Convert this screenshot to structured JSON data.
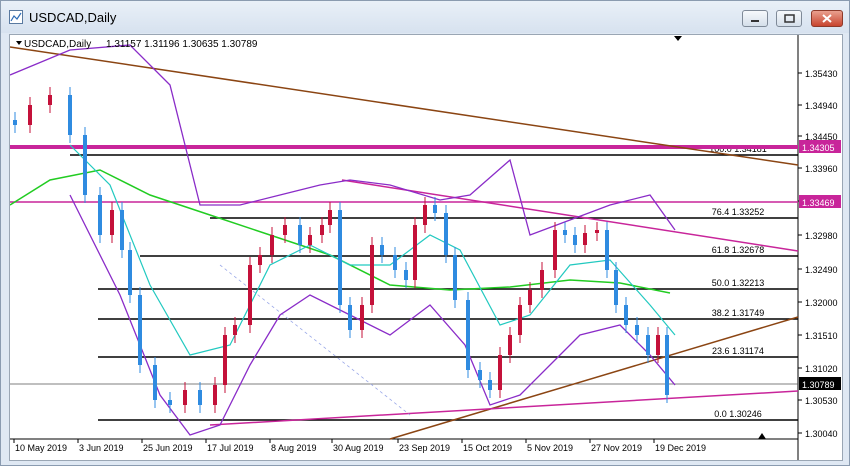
{
  "window": {
    "title": "USDCAD,Daily"
  },
  "chart_data": {
    "type": "candlestick",
    "symbol_label": "USDCAD,Daily",
    "ohlc_label": "1.31157 1.31196 1.30635 1.30789",
    "price_labels": [
      "1.35430",
      "1.34940",
      "1.34450",
      "1.33960",
      "1.33469",
      "1.32980",
      "1.32490",
      "1.32000",
      "1.31510",
      "1.31020",
      "1.30789",
      "1.30530",
      "1.30040"
    ],
    "x_labels": [
      "10 May 2019",
      "3 Jun 2019",
      "25 Jun 2019",
      "17 Jul 2019",
      "8 Aug 2019",
      "30 Aug 2019",
      "23 Sep 2019",
      "15 Oct 2019",
      "5 Nov 2019",
      "27 Nov 2019",
      "19 Dec 2019"
    ],
    "highlight_labels": {
      "upper": "1.34305",
      "mid": "1.33469",
      "current": "1.30789"
    },
    "fibonacci": [
      {
        "label": "100.0 1.34181"
      },
      {
        "label": "76.4 1.33252"
      },
      {
        "label": "61.8 1.32678"
      },
      {
        "label": "50.0 1.32213"
      },
      {
        "label": "38.2 1.31749"
      },
      {
        "label": "23.6 1.31174"
      },
      {
        "label": "0.0 1.30246"
      }
    ],
    "colors": {
      "bull": "#c4113a",
      "bear": "#2f8be0",
      "ma_green": "#22cc22",
      "bb_inner": "#22c9c0",
      "bb_outer": "#8a2cc8",
      "trend_brown": "#8b4513",
      "level_magenta": "#c8259a"
    }
  }
}
